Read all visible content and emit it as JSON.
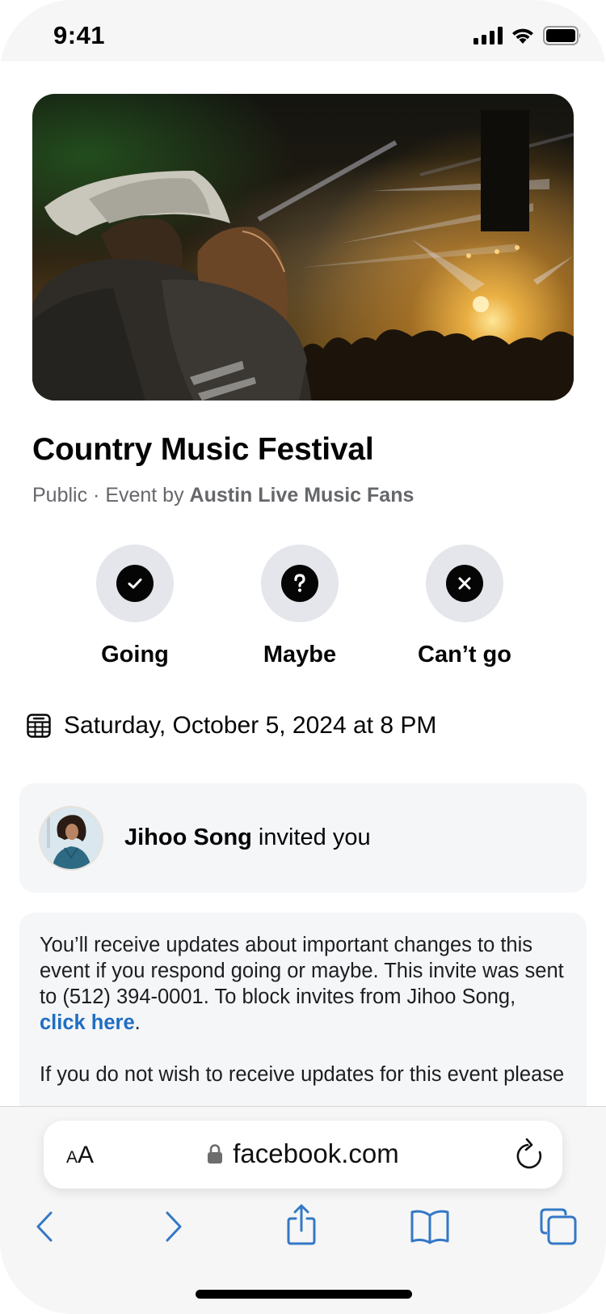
{
  "status_bar": {
    "time": "9:41",
    "icons": [
      "cellular-signal-icon",
      "wifi-icon",
      "battery-icon"
    ]
  },
  "event": {
    "cover_image": "concert-crowd-photo",
    "title": "Country Music Festival",
    "privacy": "Public",
    "separator": " · ",
    "by_prefix": "Event by ",
    "host": "Austin Live Music Fans",
    "rsvp": [
      {
        "label": "Going",
        "icon": "check-circle-icon"
      },
      {
        "label": "Maybe",
        "icon": "question-circle-icon"
      },
      {
        "label": "Can’t go",
        "icon": "x-circle-icon"
      }
    ],
    "date_icon": "calendar-icon",
    "date": "Saturday, October 5, 2024 at 8 PM"
  },
  "invite": {
    "inviter": "Jihoo Song",
    "suffix": " invited you"
  },
  "info": {
    "para1_before": "You’ll receive updates about important changes to this event if you respond going or maybe. This invite was sent to (512) 394-0001. To block invites from Jihoo Song, ",
    "link_label": "click here",
    "para1_after": ".",
    "para2": "If you do not wish to receive updates for this event please"
  },
  "browser": {
    "text_size_small": "A",
    "text_size_big": "A",
    "url": "facebook.com",
    "toolbar": [
      "back-icon",
      "forward-icon",
      "share-icon",
      "bookmarks-icon",
      "tabs-icon"
    ],
    "accent_color": "#3478c6"
  },
  "colors": {
    "link": "#1f6ec3",
    "secondary_text": "#65676b",
    "card_bg": "#f5f6f8",
    "rsvp_bg": "#e4e6eb"
  }
}
